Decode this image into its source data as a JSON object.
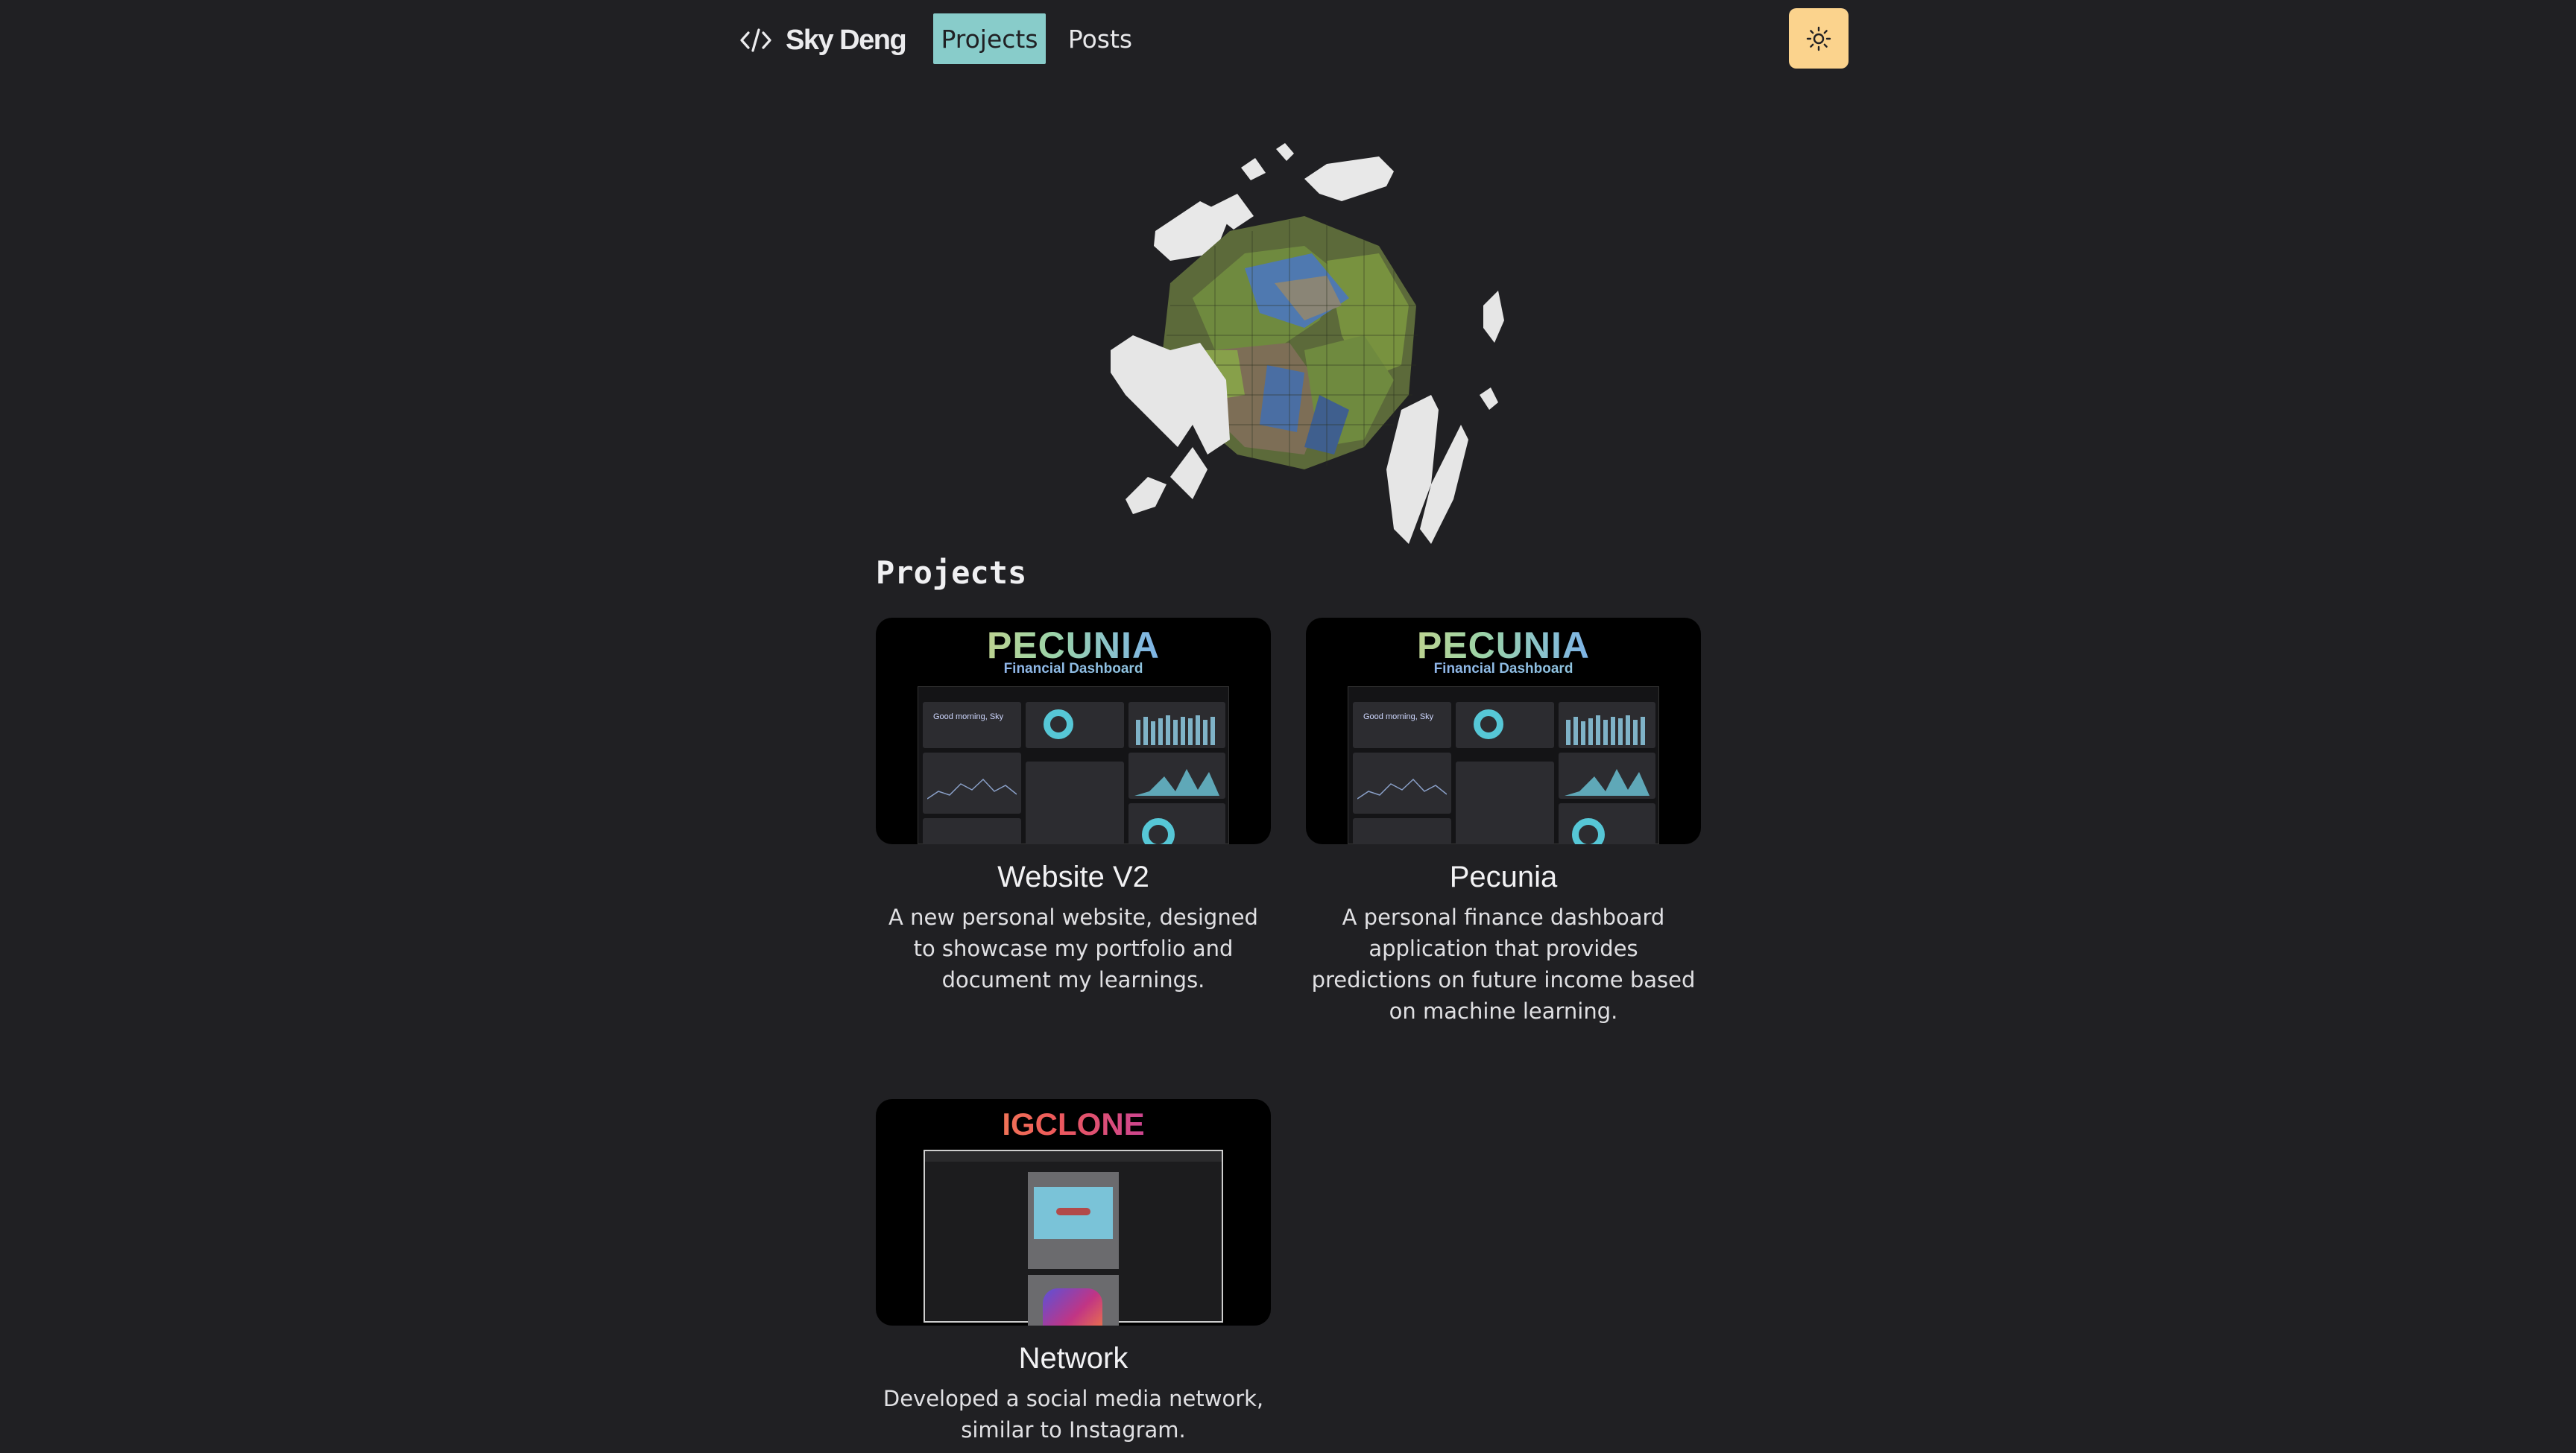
{
  "header": {
    "brand": "Sky Deng",
    "nav": [
      {
        "label": "Projects",
        "active": true
      },
      {
        "label": "Posts",
        "active": false
      }
    ],
    "theme_toggle_icon": "sun-icon",
    "colors": {
      "background": "#202023",
      "active_nav": "#88ccca",
      "toggle": "#fbd38d"
    }
  },
  "main": {
    "section_title": "Projects",
    "projects": [
      {
        "title": "Website V2",
        "description": "A new personal website, designed to showcase my portfolio and document my learnings.",
        "thumb": {
          "heading": "PECUNIA",
          "subheading": "Financial Dashboard",
          "greeting": "Good morning, Sky"
        }
      },
      {
        "title": "Pecunia",
        "description": "A personal finance dashboard application that provides predictions on future income based on machine learning.",
        "thumb": {
          "heading": "PECUNIA",
          "subheading": "Financial Dashboard",
          "greeting": "Good morning, Sky"
        }
      },
      {
        "title": "Network",
        "description": "Developed a social media network, similar to Instagram.",
        "thumb": {
          "heading": "IGCLONE"
        }
      }
    ]
  }
}
